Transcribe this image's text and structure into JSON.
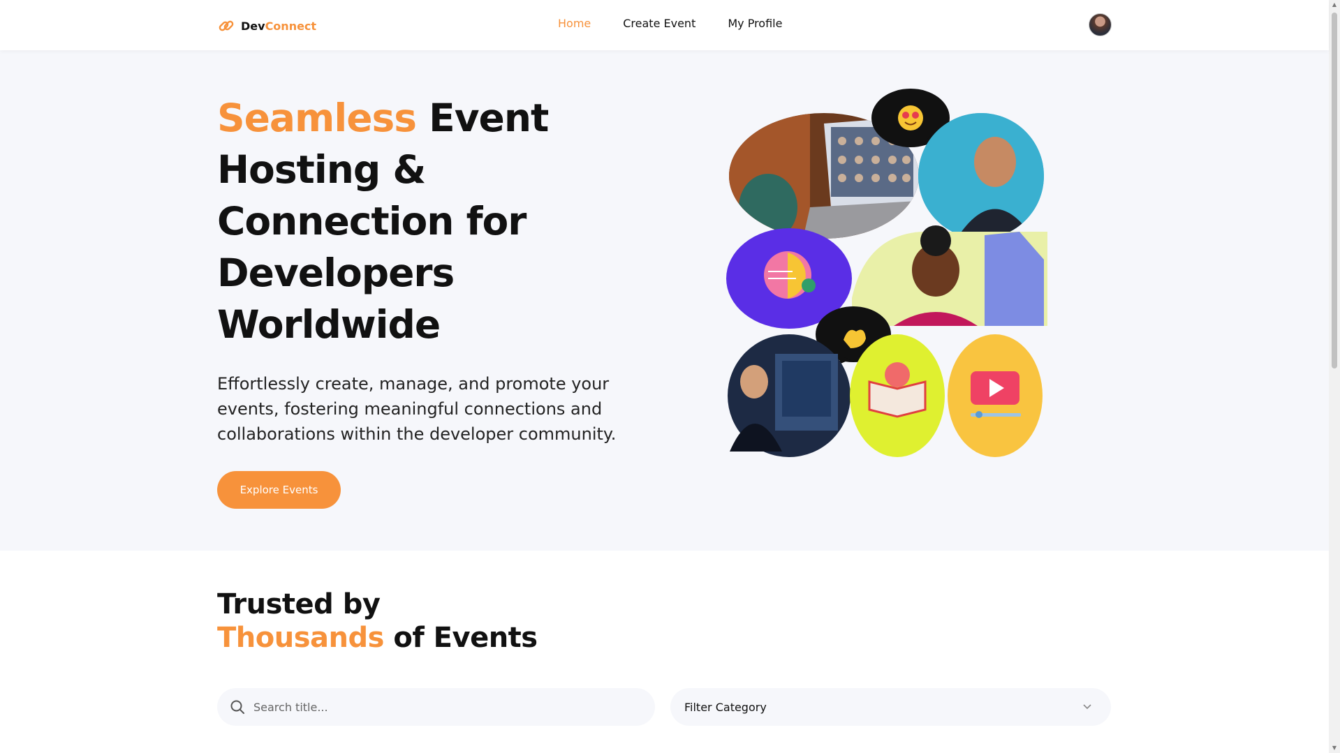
{
  "header": {
    "brand_part1": "Dev",
    "brand_part2": "Connect",
    "nav": [
      {
        "label": "Home",
        "active": true
      },
      {
        "label": "Create Event",
        "active": false
      },
      {
        "label": "My Profile",
        "active": false
      }
    ]
  },
  "hero": {
    "title_accent": "Seamless",
    "title_rest": " Event Hosting & Connection for Developers Worldwide",
    "description": "Effortlessly create, manage, and promote your events, fostering meaningful connections and collaborations within the developer community.",
    "cta_label": "Explore Events"
  },
  "trusted": {
    "line1": "Trusted by",
    "accent": "Thousands",
    "line2_rest": " of Events"
  },
  "search": {
    "placeholder": "Search title...",
    "value": ""
  },
  "filter": {
    "label": "Filter Category"
  },
  "colors": {
    "accent": "#f7923b",
    "hero_bg": "#f6f7fb",
    "text": "#111111"
  },
  "icons": {
    "logo": "link-chain-icon",
    "search": "search-icon",
    "dropdown": "chevron-down-icon"
  }
}
